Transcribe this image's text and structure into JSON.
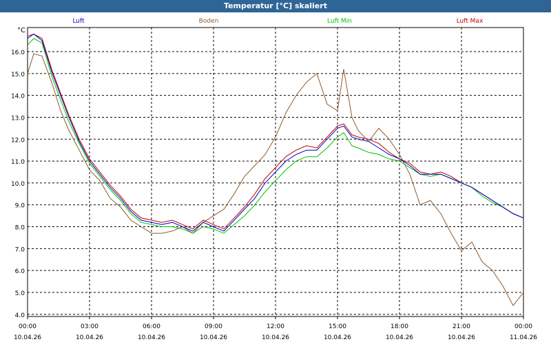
{
  "window": {
    "title": "Temperatur [°C] skaliert"
  },
  "colors": {
    "titlebar": "#2f6596"
  },
  "chart_data": {
    "type": "line",
    "title": "Temperatur [°C] skaliert",
    "ylabel": "°C",
    "xlabel": "",
    "ylim": [
      3.9,
      17.1
    ],
    "xlim": [
      0,
      24
    ],
    "grid": true,
    "legend": "top",
    "y_ticks": [
      "4.0",
      "5.0",
      "6.0",
      "7.0",
      "8.0",
      "9.0",
      "10.0",
      "11.0",
      "12.0",
      "13.0",
      "14.0",
      "15.0",
      "16.0"
    ],
    "x_ticks": [
      {
        "time": "00:00",
        "date": "10.04.26"
      },
      {
        "time": "03:00",
        "date": "10.04.26"
      },
      {
        "time": "06:00",
        "date": "10.04.26"
      },
      {
        "time": "09:00",
        "date": "10.04.26"
      },
      {
        "time": "12:00",
        "date": "10.04.26"
      },
      {
        "time": "15:00",
        "date": "10.04.26"
      },
      {
        "time": "18:00",
        "date": "10.04.26"
      },
      {
        "time": "21:00",
        "date": "10.04.26"
      },
      {
        "time": "00:00",
        "date": "11.04.26"
      }
    ],
    "series": [
      {
        "name": "Luft",
        "color": "#0000c0",
        "x": [
          0,
          0.3,
          0.7,
          1.2,
          1.6,
          2,
          2.5,
          3,
          3.5,
          4,
          4.5,
          5,
          5.5,
          6,
          6.5,
          7,
          7.5,
          8,
          8.5,
          9,
          9.5,
          10,
          10.5,
          11,
          11.5,
          12,
          12.5,
          13,
          13.5,
          14,
          14.5,
          15,
          15.3,
          15.7,
          16,
          16.5,
          17,
          17.5,
          18,
          18.5,
          19,
          19.5,
          20,
          20.5,
          21,
          21.5,
          22,
          22.5,
          23,
          23.5,
          24
        ],
        "y": [
          16.6,
          16.8,
          16.5,
          15.0,
          14.0,
          13.0,
          11.9,
          11.0,
          10.4,
          9.8,
          9.3,
          8.7,
          8.3,
          8.2,
          8.1,
          8.2,
          8.0,
          7.8,
          8.2,
          8.0,
          7.8,
          8.3,
          8.8,
          9.3,
          10.0,
          10.5,
          11.0,
          11.3,
          11.5,
          11.5,
          12.0,
          12.5,
          12.6,
          12.1,
          12.0,
          11.9,
          11.6,
          11.3,
          11.1,
          10.8,
          10.4,
          10.4,
          10.4,
          10.2,
          10.0,
          9.8,
          9.5,
          9.2,
          8.9,
          8.6,
          8.4
        ]
      },
      {
        "name": "Boden",
        "color": "#8b5a2b",
        "x": [
          0,
          0.3,
          0.7,
          1.2,
          1.6,
          2,
          2.5,
          3,
          3.5,
          4,
          4.5,
          5,
          5.5,
          6,
          6.5,
          7,
          7.5,
          8,
          8.5,
          9,
          9.5,
          10,
          10.5,
          11,
          11.5,
          12,
          12.5,
          13,
          13.5,
          14,
          14.5,
          15,
          15.3,
          15.7,
          16,
          16.5,
          17,
          17.5,
          18,
          18.5,
          19,
          19.5,
          20,
          20.5,
          21,
          21.5,
          22,
          22.5,
          23,
          23.5,
          24
        ],
        "y": [
          15.0,
          15.9,
          15.8,
          14.5,
          13.3,
          12.4,
          11.5,
          10.6,
          10.1,
          9.3,
          8.9,
          8.3,
          8.0,
          7.7,
          7.7,
          7.8,
          8.0,
          7.7,
          8.2,
          8.5,
          8.8,
          9.5,
          10.3,
          10.8,
          11.3,
          12.1,
          13.2,
          14.0,
          14.6,
          15.0,
          13.6,
          13.3,
          15.2,
          13.0,
          12.4,
          11.9,
          12.5,
          12.0,
          11.3,
          10.4,
          9.0,
          9.2,
          8.6,
          7.7,
          6.9,
          7.3,
          6.4,
          6.0,
          5.3,
          4.4,
          5.0
        ]
      },
      {
        "name": "Luft Min",
        "color": "#00c000",
        "x": [
          0,
          0.3,
          0.7,
          1.2,
          1.6,
          2,
          2.5,
          3,
          3.5,
          4,
          4.5,
          5,
          5.5,
          6,
          6.5,
          7,
          7.5,
          8,
          8.5,
          9,
          9.5,
          10,
          10.5,
          11,
          11.5,
          12,
          12.5,
          13,
          13.5,
          14,
          14.5,
          15,
          15.3,
          15.7,
          16,
          16.5,
          17,
          17.5,
          18,
          18.5,
          19,
          19.5,
          20,
          20.5,
          21,
          21.5,
          22,
          22.5,
          23,
          23.5,
          24
        ],
        "y": [
          16.3,
          16.6,
          16.4,
          14.8,
          13.8,
          12.8,
          11.8,
          10.9,
          10.3,
          9.7,
          9.2,
          8.6,
          8.2,
          8.1,
          8.0,
          8.0,
          7.9,
          7.7,
          8.0,
          7.9,
          7.7,
          8.1,
          8.5,
          9.0,
          9.6,
          10.1,
          10.6,
          11.0,
          11.2,
          11.2,
          11.6,
          12.1,
          12.3,
          11.7,
          11.6,
          11.4,
          11.3,
          11.1,
          11.0,
          10.7,
          10.4,
          10.3,
          10.4,
          10.2,
          10.0,
          9.8,
          9.4,
          9.1,
          8.9,
          8.6,
          8.4
        ]
      },
      {
        "name": "Luft Max",
        "color": "#c00000",
        "x": [
          0,
          0.3,
          0.7,
          1.2,
          1.6,
          2,
          2.5,
          3,
          3.5,
          4,
          4.5,
          5,
          5.5,
          6,
          6.5,
          7,
          7.5,
          8,
          8.5,
          9,
          9.5,
          10,
          10.5,
          11,
          11.5,
          12,
          12.5,
          13,
          13.5,
          14,
          14.5,
          15,
          15.3,
          15.7,
          16,
          16.5,
          17,
          17.5,
          18,
          18.5,
          19,
          19.5,
          20,
          20.5,
          21,
          21.5,
          22,
          22.5,
          23,
          23.5,
          24
        ],
        "y": [
          16.7,
          16.8,
          16.6,
          15.1,
          14.1,
          13.1,
          12.0,
          11.1,
          10.5,
          9.9,
          9.4,
          8.8,
          8.4,
          8.3,
          8.2,
          8.3,
          8.1,
          7.9,
          8.3,
          8.1,
          7.9,
          8.4,
          8.9,
          9.5,
          10.2,
          10.7,
          11.2,
          11.5,
          11.7,
          11.6,
          12.1,
          12.6,
          12.7,
          12.2,
          12.1,
          12.0,
          11.8,
          11.4,
          11.1,
          10.9,
          10.5,
          10.4,
          10.5,
          10.3,
          10.0,
          9.8,
          9.5,
          9.2,
          8.9,
          8.6,
          8.4
        ]
      }
    ]
  }
}
